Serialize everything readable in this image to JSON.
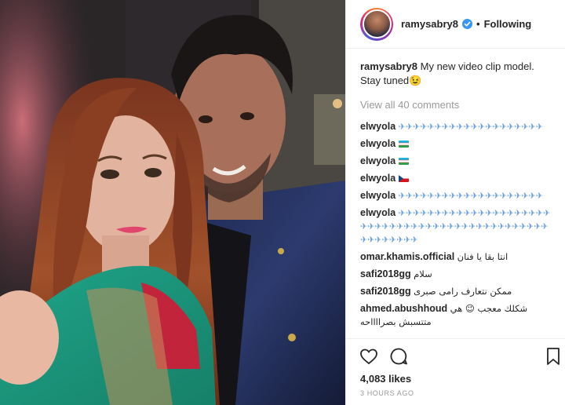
{
  "post": {
    "username": "ramysabry8",
    "dot": "•",
    "follow_label": "Following",
    "caption_user": "ramysabry8",
    "caption_text": "My new video clip model. Stay tuned",
    "caption_emoji": "😉",
    "view_all": "View all 40 comments",
    "likes": "4,083 likes",
    "time": "3 HOURS AGO"
  },
  "comments": [
    {
      "user": "elwyola",
      "text": "✈✈✈✈✈✈✈✈✈✈✈✈✈✈✈✈✈✈✈✈"
    },
    {
      "user": "elwyola",
      "text": "",
      "flag": "uzbekistan"
    },
    {
      "user": "elwyola",
      "text": "",
      "flag": "uzbekistan"
    },
    {
      "user": "elwyola",
      "text": "",
      "flag": "czech"
    },
    {
      "user": "elwyola",
      "text": "✈✈✈✈✈✈✈✈✈✈✈✈✈✈✈✈✈✈✈✈"
    },
    {
      "user": "elwyola",
      "text": "✈✈✈✈✈✈✈✈✈✈✈✈✈✈✈✈✈✈✈✈✈✈✈✈✈✈✈✈✈✈✈✈✈✈✈✈✈✈✈✈✈✈✈✈✈✈✈✈✈✈✈✈✈✈✈"
    },
    {
      "user": "omar.khamis.official",
      "text": "انتا بقا يا فنان"
    },
    {
      "user": "safi2018gg",
      "text": "سلام"
    },
    {
      "user": "safi2018gg",
      "text": "ممكن نتعارف رامى صبرى"
    },
    {
      "user": "ahmed.abushhoud",
      "text": "شكلك معجب 😉 هي متتسبش بصرااااحه"
    }
  ],
  "icons": {
    "verified": "verified-badge-icon",
    "like": "heart-icon",
    "comment": "comment-bubble-icon",
    "save": "bookmark-icon"
  },
  "colors": {
    "accent_blue": "#3897f0",
    "text": "#262626",
    "muted": "#999999",
    "border": "#efefef"
  }
}
